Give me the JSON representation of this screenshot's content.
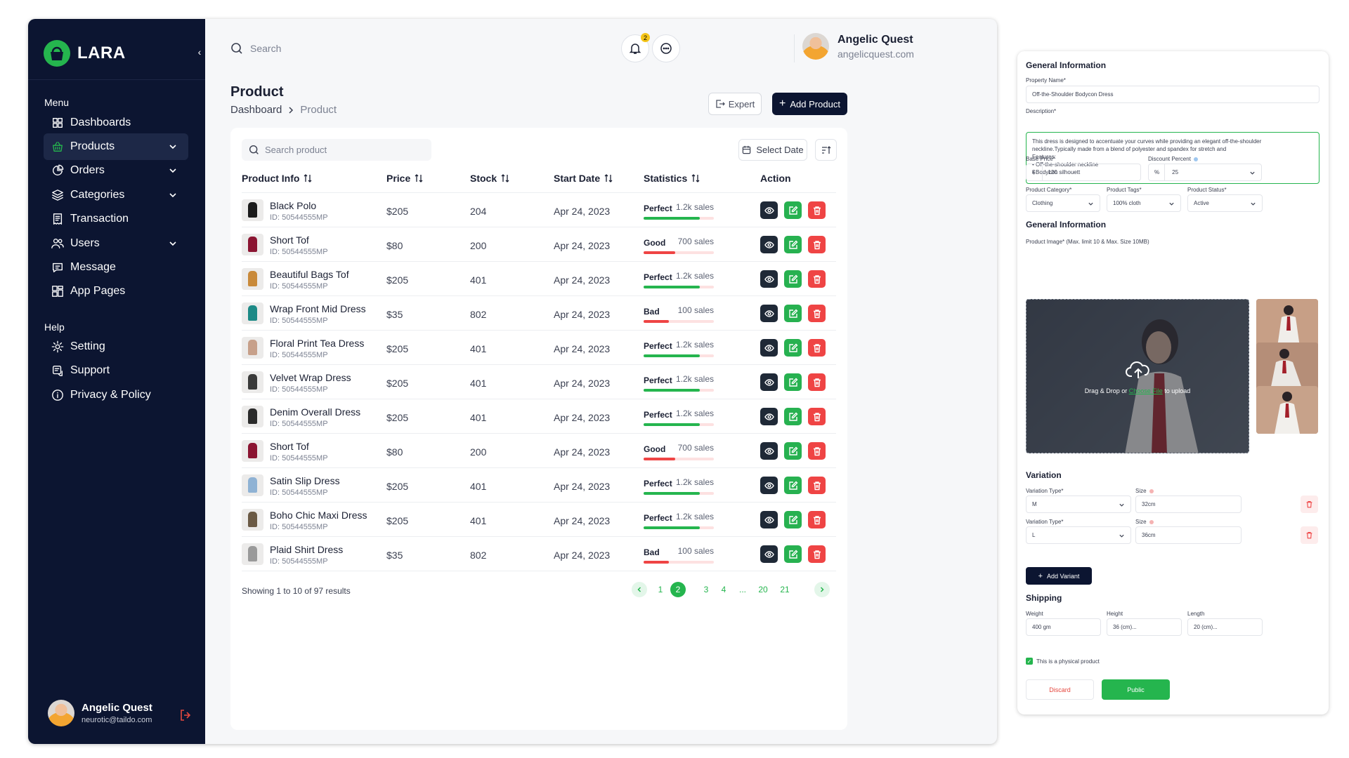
{
  "app": {
    "name": "LARA"
  },
  "sidebar": {
    "menu_label": "Menu",
    "help_label": "Help",
    "items": [
      {
        "label": "Dashboards",
        "icon": "grid-icon",
        "chevron": false,
        "active": false
      },
      {
        "label": "Products",
        "icon": "basket-icon",
        "chevron": true,
        "active": true
      },
      {
        "label": "Orders",
        "icon": "pie-chart-icon",
        "chevron": true,
        "active": false
      },
      {
        "label": "Categories",
        "icon": "layers-icon",
        "chevron": true,
        "active": false
      },
      {
        "label": "Transaction",
        "icon": "receipt-icon",
        "chevron": false,
        "active": false
      },
      {
        "label": "Users",
        "icon": "users-icon",
        "chevron": true,
        "active": false
      },
      {
        "label": "Message",
        "icon": "message-icon",
        "chevron": false,
        "active": false
      },
      {
        "label": "App Pages",
        "icon": "pages-icon",
        "chevron": false,
        "active": false
      }
    ],
    "help_items": [
      {
        "label": "Setting",
        "icon": "gear-icon"
      },
      {
        "label": "Support",
        "icon": "support-icon"
      },
      {
        "label": "Privacy & Policy",
        "icon": "info-icon"
      }
    ],
    "user": {
      "name": "Angelic Quest",
      "email": "neurotic@taildo.com"
    }
  },
  "header": {
    "search_placeholder": "Search",
    "notification_count": "2",
    "user": {
      "name": "Angelic Quest",
      "email": "angelicquest.com"
    }
  },
  "page": {
    "title": "Product",
    "breadcrumb": [
      "Dashboard",
      "Product"
    ],
    "export_label": "Expert",
    "add_label": "Add Product"
  },
  "table": {
    "search_placeholder": "Search product",
    "date_label": "Select Date",
    "columns": [
      "Product Info",
      "Price",
      "Stock",
      "Start Date",
      "Statistics",
      "Action"
    ],
    "rows": [
      {
        "name": "Black Polo",
        "id": "ID: 50544555MP",
        "price": "$205",
        "stock": "204",
        "date": "Apr 24, 2023",
        "status": "Perfect",
        "sales": "1.2k sales",
        "level": 0.8,
        "swatch": "#1b1b1b"
      },
      {
        "name": "Short Tof",
        "id": "ID: 50544555MP",
        "price": "$80",
        "stock": "200",
        "date": "Apr 24, 2023",
        "status": "Good",
        "sales": "700 sales",
        "level": 0.45,
        "swatch": "#8b1532"
      },
      {
        "name": "Beautiful Bags Tof",
        "id": "ID: 50544555MP",
        "price": "$205",
        "stock": "401",
        "date": "Apr 24, 2023",
        "status": "Perfect",
        "sales": "1.2k sales",
        "level": 0.8,
        "swatch": "#c98a3a"
      },
      {
        "name": "Wrap Front Mid Dress",
        "id": "ID: 50544555MP",
        "price": "$35",
        "stock": "802",
        "date": "Apr 24, 2023",
        "status": "Bad",
        "sales": "100 sales",
        "level": 0.36,
        "swatch": "#1d8a86"
      },
      {
        "name": "Floral Print Tea Dress",
        "id": "ID: 50544555MP",
        "price": "$205",
        "stock": "401",
        "date": "Apr 24, 2023",
        "status": "Perfect",
        "sales": "1.2k sales",
        "level": 0.8,
        "swatch": "#c7a08a"
      },
      {
        "name": "Velvet Wrap Dress",
        "id": "ID: 50544555MP",
        "price": "$205",
        "stock": "401",
        "date": "Apr 24, 2023",
        "status": "Perfect",
        "sales": "1.2k sales",
        "level": 0.8,
        "swatch": "#3a3a3a"
      },
      {
        "name": "Denim Overall Dress",
        "id": "ID: 50544555MP",
        "price": "$205",
        "stock": "401",
        "date": "Apr 24, 2023",
        "status": "Perfect",
        "sales": "1.2k sales",
        "level": 0.8,
        "swatch": "#2b2b2b"
      },
      {
        "name": "Short Tof",
        "id": "ID: 50544555MP",
        "price": "$80",
        "stock": "200",
        "date": "Apr 24, 2023",
        "status": "Good",
        "sales": "700 sales",
        "level": 0.45,
        "swatch": "#8b1532"
      },
      {
        "name": "Satin Slip Dress",
        "id": "ID: 50544555MP",
        "price": "$205",
        "stock": "401",
        "date": "Apr 24, 2023",
        "status": "Perfect",
        "sales": "1.2k sales",
        "level": 0.8,
        "swatch": "#8fb2d4"
      },
      {
        "name": "Boho Chic Maxi Dress",
        "id": "ID: 50544555MP",
        "price": "$205",
        "stock": "401",
        "date": "Apr 24, 2023",
        "status": "Perfect",
        "sales": "1.2k sales",
        "level": 0.8,
        "swatch": "#6b5a45"
      },
      {
        "name": "Plaid Shirt Dress",
        "id": "ID: 50544555MP",
        "price": "$35",
        "stock": "802",
        "date": "Apr 24, 2023",
        "status": "Bad",
        "sales": "100 sales",
        "level": 0.36,
        "swatch": "#9a9a9a"
      }
    ],
    "footer": "Showing 1 to 10 of 97 results",
    "pages": [
      "1",
      "2",
      "3",
      "4",
      "...",
      "20",
      "21"
    ],
    "current_page": "2"
  },
  "form": {
    "general_title": "General Information",
    "property_label": "Property Name*",
    "property_value": "Off-the-Shoulder Bodycon Dress",
    "description_label": "Description*",
    "description_lines": [
      "This dress is designed to accentuate your curves while providing an elegant off-the-shoulder",
      "neckline.Typically made from a blend of polyester and spandex for stretch and",
      "Features:",
      "• Off-the-shoulder neckline",
      "• Bodycon silhouett"
    ],
    "base_price_label": "Base Price*",
    "currency": "$",
    "base_price": "120",
    "discount_label": "Discount Percent",
    "percent": "%",
    "discount": "25",
    "category_label": "Product Category*",
    "category": "Clothing",
    "tags_label": "Product Tags*",
    "tags": "100% cloth",
    "status_label": "Product Status*",
    "status": "Active",
    "image_section_title": "General Information",
    "image_label": "Product Image* (Max. limit 10 & Max. Size 10MB)",
    "drop_text_before": "Drag & Drop or ",
    "drop_link": "Choose File",
    "drop_text_after": " to upload",
    "variation_title": "Variation",
    "variants": [
      {
        "type_label": "Variation Type*",
        "type": "M",
        "size_label": "Size",
        "size": "32cm"
      },
      {
        "type_label": "Variation Type*",
        "type": "L",
        "size_label": "Size",
        "size": "36cm"
      }
    ],
    "add_variant": "Add Variant",
    "shipping_title": "Shipping",
    "weight_label": "Weight",
    "weight": "400 gm",
    "height_label": "Height",
    "height": "36 (cm)...",
    "length_label": "Length",
    "length": "20 (cm)...",
    "physical_label": "This is a physical product",
    "discard": "Discard",
    "public": "Public"
  },
  "colors": {
    "sidebar": "#0c1531",
    "accent": "#25b54e",
    "danger": "#ef4444",
    "dark_button": "#1f2937"
  }
}
